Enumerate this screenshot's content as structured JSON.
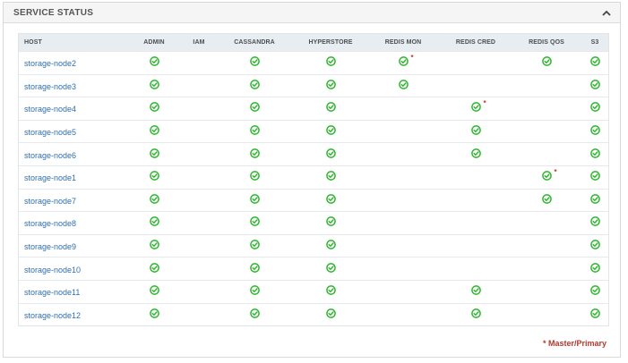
{
  "panel": {
    "title": "SERVICE STATUS",
    "collapse_icon": "chevron-up-icon"
  },
  "table": {
    "columns": [
      "HOST",
      "ADMIN",
      "IAM",
      "CASSANDRA",
      "HYPERSTORE",
      "REDIS MON",
      "REDIS CRED",
      "REDIS QOS",
      "S3"
    ],
    "rows": [
      {
        "host": "storage-node2",
        "services": [
          "ok",
          "",
          "ok",
          "ok",
          "master",
          "",
          "ok",
          "ok"
        ]
      },
      {
        "host": "storage-node3",
        "services": [
          "ok",
          "",
          "ok",
          "ok",
          "ok",
          "",
          "",
          "ok"
        ]
      },
      {
        "host": "storage-node4",
        "services": [
          "ok",
          "",
          "ok",
          "ok",
          "",
          "master",
          "",
          "ok"
        ]
      },
      {
        "host": "storage-node5",
        "services": [
          "ok",
          "",
          "ok",
          "ok",
          "",
          "ok",
          "",
          "ok"
        ]
      },
      {
        "host": "storage-node6",
        "services": [
          "ok",
          "",
          "ok",
          "ok",
          "",
          "ok",
          "",
          "ok"
        ]
      },
      {
        "host": "storage-node1",
        "services": [
          "ok",
          "",
          "ok",
          "ok",
          "",
          "",
          "master",
          "ok"
        ]
      },
      {
        "host": "storage-node7",
        "services": [
          "ok",
          "",
          "ok",
          "ok",
          "",
          "",
          "ok",
          "ok"
        ]
      },
      {
        "host": "storage-node8",
        "services": [
          "ok",
          "",
          "ok",
          "ok",
          "",
          "",
          "",
          "ok"
        ]
      },
      {
        "host": "storage-node9",
        "services": [
          "ok",
          "",
          "ok",
          "ok",
          "",
          "",
          "",
          "ok"
        ]
      },
      {
        "host": "storage-node10",
        "services": [
          "ok",
          "",
          "ok",
          "ok",
          "",
          "",
          "",
          "ok"
        ]
      },
      {
        "host": "storage-node11",
        "services": [
          "ok",
          "",
          "ok",
          "ok",
          "",
          "ok",
          "",
          "ok"
        ]
      },
      {
        "host": "storage-node12",
        "services": [
          "ok",
          "",
          "ok",
          "ok",
          "",
          "ok",
          "",
          "ok"
        ]
      }
    ],
    "status_icon": "check-circle-icon",
    "master_marker": "*",
    "colors": {
      "ok": "#2fb52f",
      "master": "#c0392b",
      "link": "#2f6fae"
    }
  },
  "legend": {
    "label": "* Master/Primary"
  }
}
